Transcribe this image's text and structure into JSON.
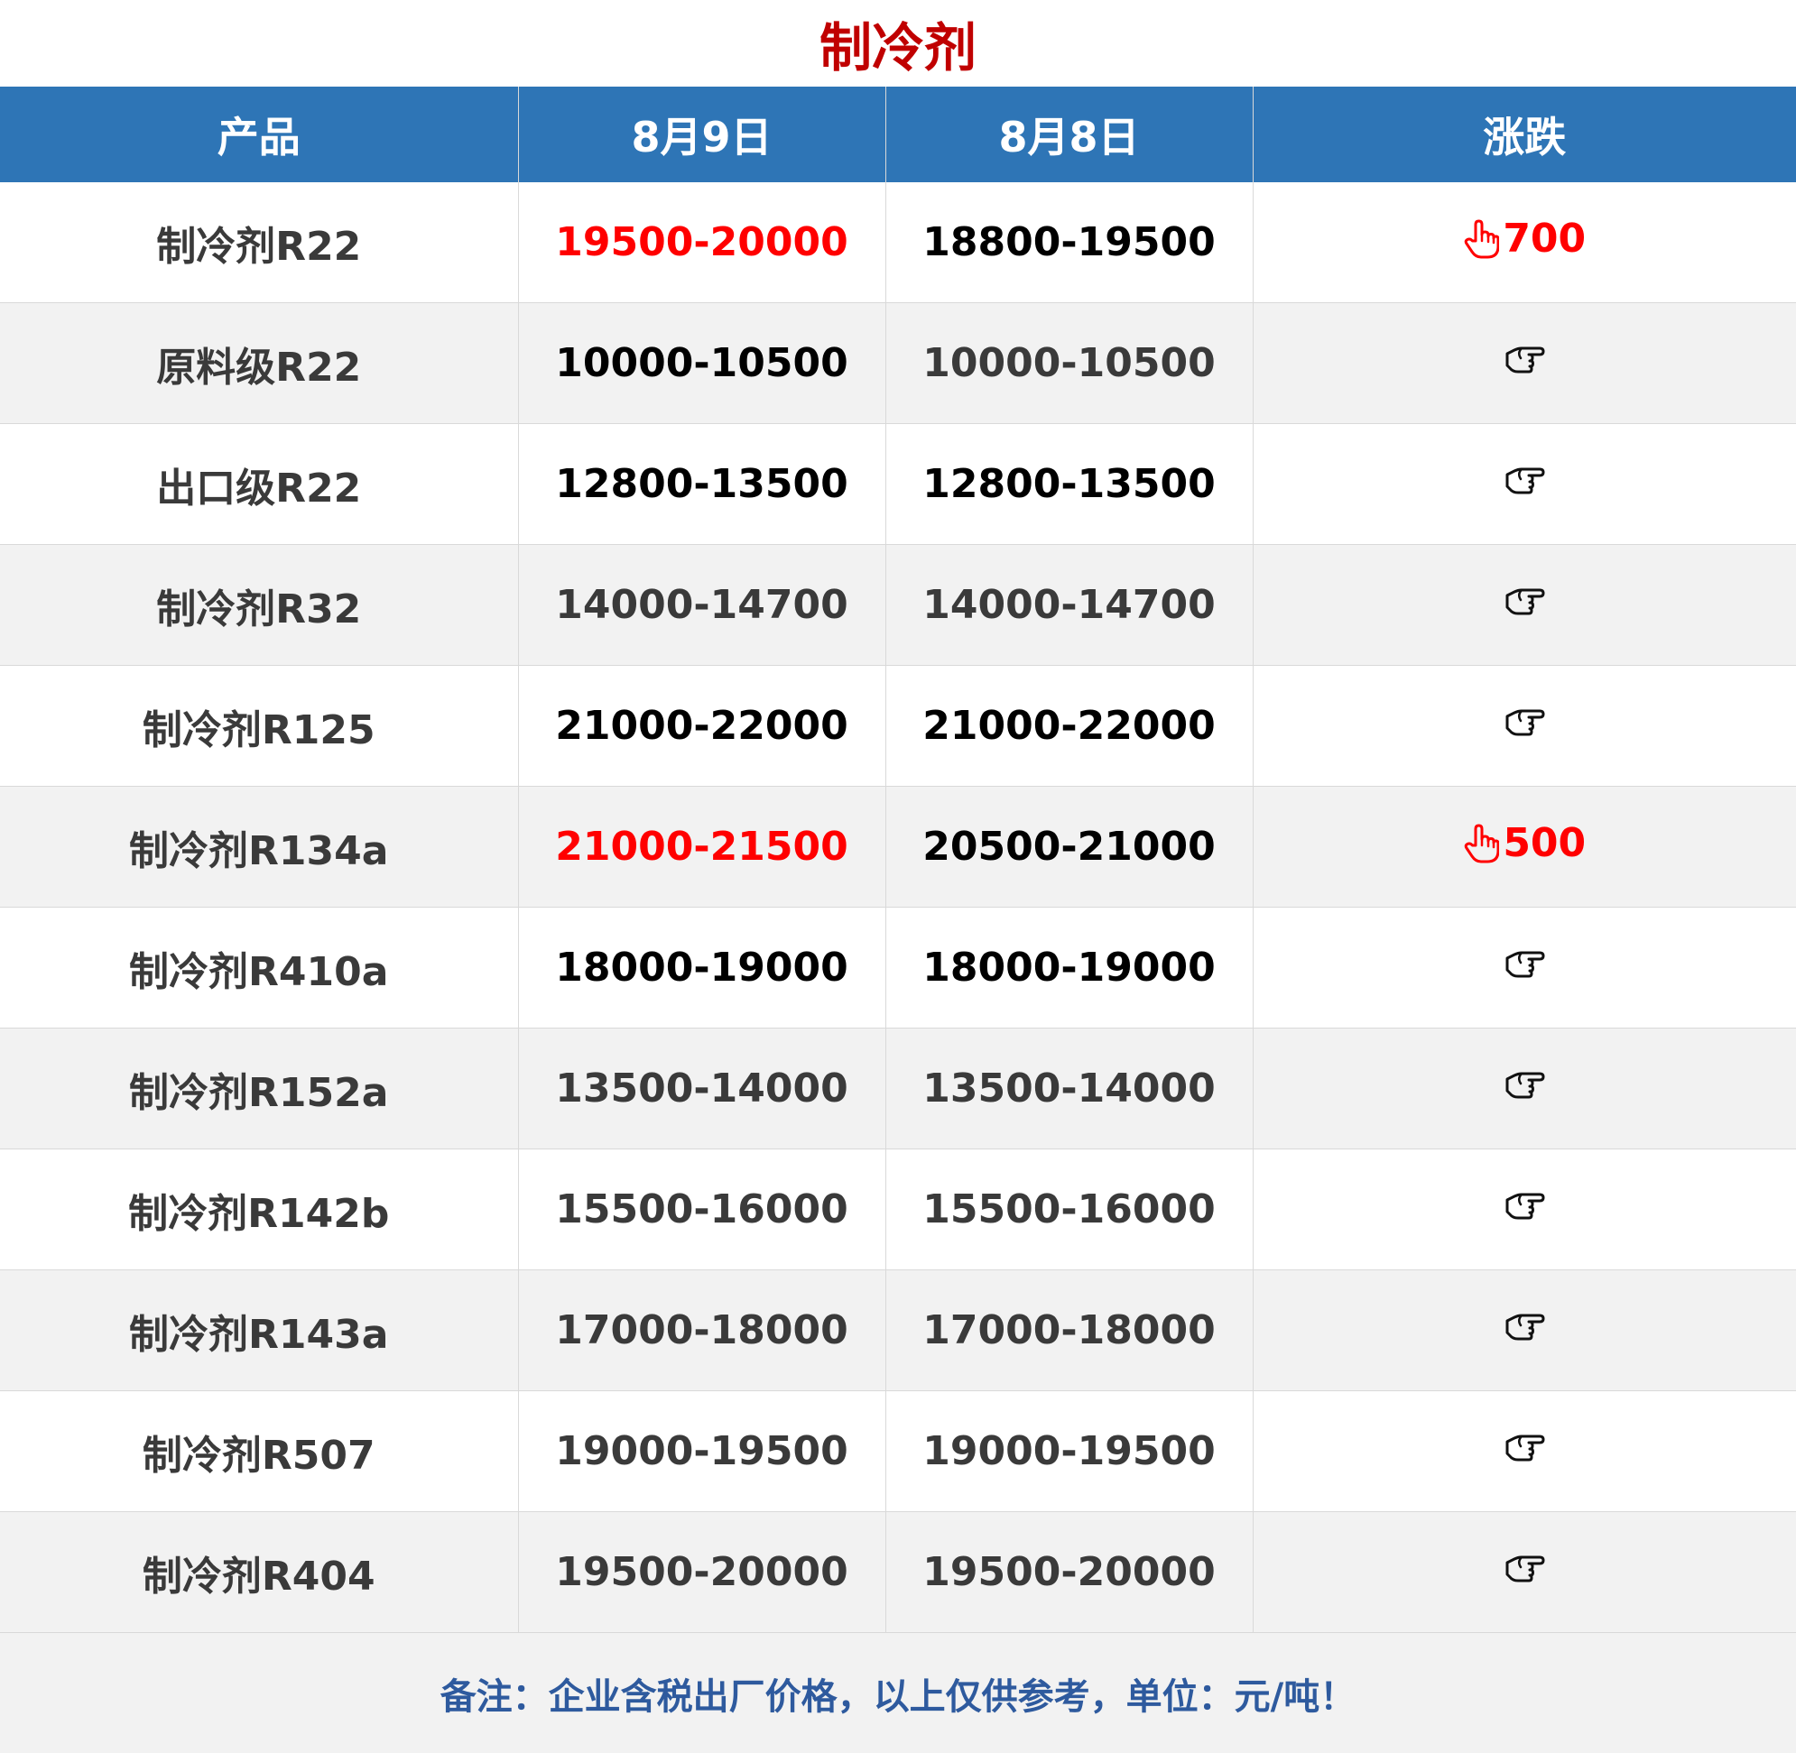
{
  "title": "制冷剂",
  "columns": [
    "产品",
    "8月9日",
    "8月8日",
    "涨跌"
  ],
  "rows": [
    {
      "product": "制冷剂R22",
      "today": "19500-20000",
      "yesterday": "18800-19500",
      "change": "700",
      "trend": "up",
      "today_style": "red",
      "yesterday_style": "dark"
    },
    {
      "product": "原料级R22",
      "today": "10000-10500",
      "yesterday": "10000-10500",
      "change": "",
      "trend": "flat",
      "today_style": "dark",
      "yesterday_style": "gray"
    },
    {
      "product": "出口级R22",
      "today": "12800-13500",
      "yesterday": "12800-13500",
      "change": "",
      "trend": "flat",
      "today_style": "dark",
      "yesterday_style": "dark"
    },
    {
      "product": "制冷剂R32",
      "today": "14000-14700",
      "yesterday": "14000-14700",
      "change": "",
      "trend": "flat",
      "today_style": "gray",
      "yesterday_style": "gray"
    },
    {
      "product": "制冷剂R125",
      "today": "21000-22000",
      "yesterday": "21000-22000",
      "change": "",
      "trend": "flat",
      "today_style": "dark",
      "yesterday_style": "dark"
    },
    {
      "product": "制冷剂R134a",
      "today": "21000-21500",
      "yesterday": "20500-21000",
      "change": "500",
      "trend": "up",
      "today_style": "red",
      "yesterday_style": "dark"
    },
    {
      "product": "制冷剂R410a",
      "today": "18000-19000",
      "yesterday": "18000-19000",
      "change": "",
      "trend": "flat",
      "today_style": "dark",
      "yesterday_style": "dark"
    },
    {
      "product": "制冷剂R152a",
      "today": "13500-14000",
      "yesterday": "13500-14000",
      "change": "",
      "trend": "flat",
      "today_style": "gray",
      "yesterday_style": "gray"
    },
    {
      "product": "制冷剂R142b",
      "today": "15500-16000",
      "yesterday": "15500-16000",
      "change": "",
      "trend": "flat",
      "today_style": "gray",
      "yesterday_style": "gray"
    },
    {
      "product": "制冷剂R143a",
      "today": "17000-18000",
      "yesterday": "17000-18000",
      "change": "",
      "trend": "flat",
      "today_style": "gray",
      "yesterday_style": "gray"
    },
    {
      "product": "制冷剂R507",
      "today": "19000-19500",
      "yesterday": "19000-19500",
      "change": "",
      "trend": "flat",
      "today_style": "gray",
      "yesterday_style": "gray"
    },
    {
      "product": "制冷剂R404",
      "today": "19500-20000",
      "yesterday": "19500-20000",
      "change": "",
      "trend": "flat",
      "today_style": "gray",
      "yesterday_style": "gray"
    }
  ],
  "footnote": "备注：企业含税出厂价格，以上仅供参考，单位：元/吨！",
  "icons": {
    "up": "hand-pointing-up-icon",
    "flat": "hand-pointing-right-icon"
  },
  "colors": {
    "header_bg": "#2e75b6",
    "title": "#c00000",
    "up": "#ff0000",
    "footnote": "#2e5a9e",
    "row_alt": "#f2f2f2"
  }
}
